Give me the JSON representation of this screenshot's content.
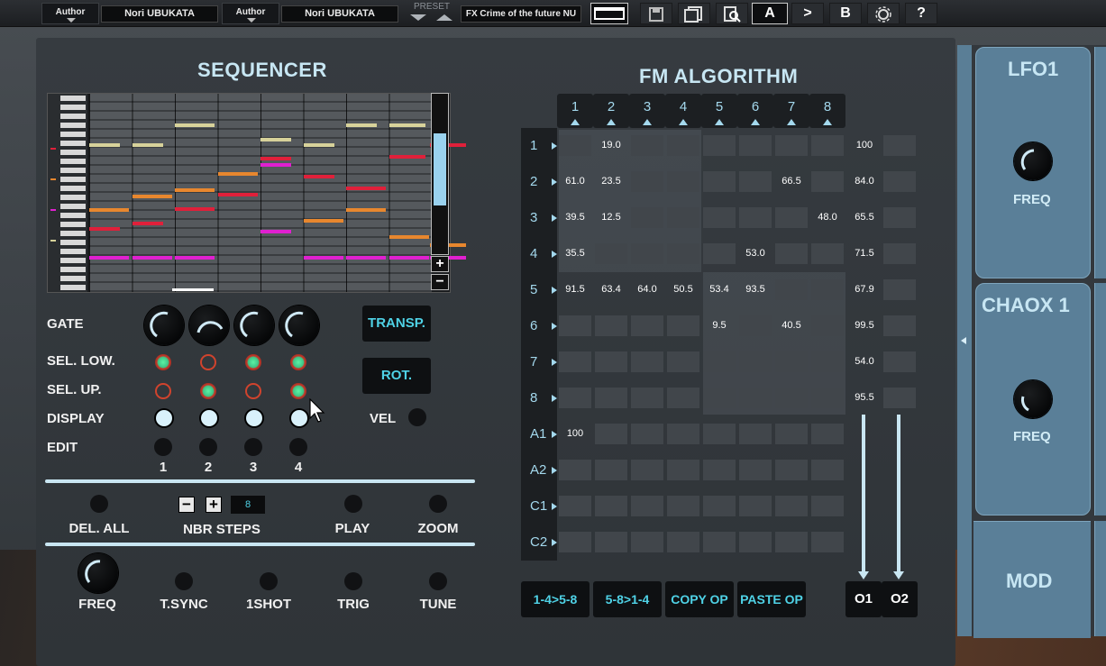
{
  "toolbar": {
    "author_label_1": "Author",
    "author_value_1": "Nori UBUKATA",
    "author_label_2": "Author",
    "author_value_2": "Nori UBUKATA",
    "preset_label": "PRESET",
    "preset_name": "FX Crime of the future NU",
    "btn_a": "A",
    "btn_next": ">",
    "btn_b": "B",
    "btn_help": "?"
  },
  "sequencer": {
    "title": "SEQUENCER",
    "gate_label": "GATE",
    "sel_low_label": "SEL. LOW.",
    "sel_up_label": "SEL. UP.",
    "display_label": "DISPLAY",
    "edit_label": "EDIT",
    "vel_label": "VEL",
    "transp_label": "TRANSP.",
    "rot_label": "ROT.",
    "track_numbers": [
      "1",
      "2",
      "3",
      "4"
    ],
    "sel_low": [
      true,
      false,
      true,
      true
    ],
    "sel_up": [
      false,
      true,
      false,
      true
    ],
    "del_all_label": "DEL. ALL",
    "nbr_steps_label": "NBR STEPS",
    "nbr_steps_value": "8",
    "play_label": "PLAY",
    "zoom_label": "ZOOM",
    "freq_label": "FREQ",
    "tsync_label": "T.SYNC",
    "oneshot_label": "1SHOT",
    "trig_label": "TRIG",
    "tune_label": "TUNE",
    "track_colors": [
      "#d7d29a",
      "#e0203a",
      "#e8872e",
      "#e020d0"
    ]
  },
  "fm": {
    "title": "FM ALGORITHM",
    "columns": [
      "1",
      "2",
      "3",
      "4",
      "5",
      "6",
      "7",
      "8"
    ],
    "rows": [
      {
        "label": "1",
        "cells": [
          "",
          "19.0",
          "",
          "",
          "",
          "",
          "",
          ""
        ],
        "out": "100"
      },
      {
        "label": "2",
        "cells": [
          "61.0",
          "23.5",
          "",
          "",
          "",
          "",
          "66.5",
          ""
        ],
        "out": "84.0"
      },
      {
        "label": "3",
        "cells": [
          "39.5",
          "12.5",
          "",
          "",
          "",
          "",
          "",
          "48.0"
        ],
        "out": "65.5"
      },
      {
        "label": "4",
        "cells": [
          "35.5",
          "",
          "",
          "",
          "",
          "53.0",
          "",
          ""
        ],
        "out": "71.5"
      },
      {
        "label": "5",
        "cells": [
          "91.5",
          "63.4",
          "64.0",
          "50.5",
          "53.4",
          "93.5",
          "",
          ""
        ],
        "out": "67.9"
      },
      {
        "label": "6",
        "cells": [
          "",
          "",
          "",
          "",
          "9.5",
          "",
          "40.5",
          ""
        ],
        "out": "99.5"
      },
      {
        "label": "7",
        "cells": [
          "",
          "",
          "",
          "",
          "",
          "",
          "",
          ""
        ],
        "out": "54.0"
      },
      {
        "label": "8",
        "cells": [
          "",
          "",
          "",
          "",
          "",
          "",
          "",
          ""
        ],
        "out": "95.5"
      },
      {
        "label": "A1",
        "cells": [
          "100",
          "",
          "",
          "",
          "",
          "",
          "",
          ""
        ],
        "out": ""
      },
      {
        "label": "A2",
        "cells": [
          "",
          "",
          "",
          "",
          "",
          "",
          "",
          ""
        ],
        "out": ""
      },
      {
        "label": "C1",
        "cells": [
          "",
          "",
          "",
          "",
          "",
          "",
          "",
          ""
        ],
        "out": ""
      },
      {
        "label": "C2",
        "cells": [
          "",
          "",
          "",
          "",
          "",
          "",
          "",
          ""
        ],
        "out": ""
      }
    ],
    "btn_14_58": "1-4>5-8",
    "btn_58_14": "5-8>1-4",
    "btn_copy": "COPY OP",
    "btn_paste": "PASTE OP",
    "out1": "O1",
    "out2": "O2"
  },
  "modules": {
    "lfo1_title": "LFO1",
    "lfo1_freq": "FREQ",
    "chaox_title": "CHAOX 1",
    "chaox_freq": "FREQ",
    "mod_title": "MOD"
  }
}
